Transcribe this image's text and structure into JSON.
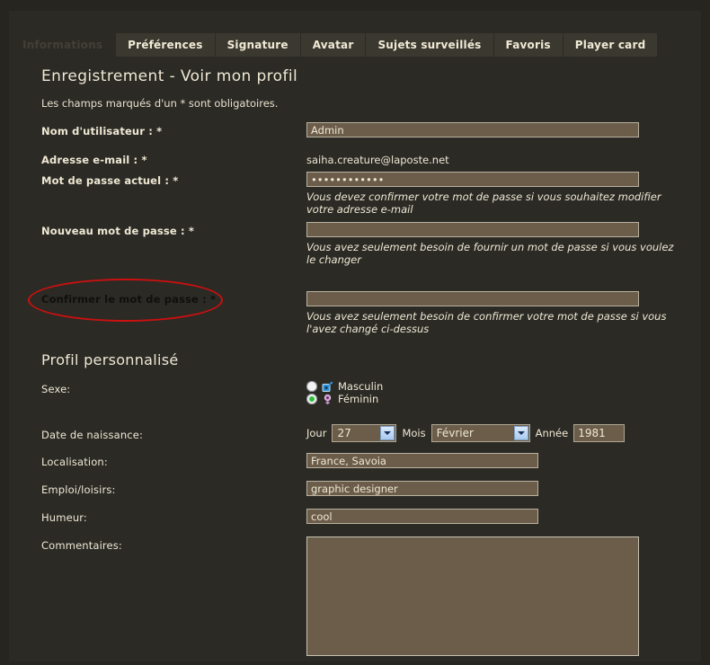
{
  "tabs": [
    {
      "label": "Informations",
      "active": true
    },
    {
      "label": "Préférences",
      "active": false
    },
    {
      "label": "Signature",
      "active": false
    },
    {
      "label": "Avatar",
      "active": false
    },
    {
      "label": "Sujets surveillés",
      "active": false
    },
    {
      "label": "Favoris",
      "active": false
    },
    {
      "label": "Player card",
      "active": false
    }
  ],
  "page": {
    "title": "Enregistrement - Voir mon profil",
    "required_note": "Les champs marqués d'un * sont obligatoires.",
    "profile_section_title": "Profil personnalisé"
  },
  "form": {
    "username": {
      "label": "Nom d'utilisateur : *",
      "value": "Admin"
    },
    "email": {
      "label": "Adresse e-mail : *",
      "value": "saiha.creature@laposte.net"
    },
    "current_password": {
      "label": "Mot de passe actuel : *",
      "value": "••••••••••••",
      "hint": "Vous devez confirmer votre mot de passe si vous souhaitez modifier votre adresse e-mail"
    },
    "new_password": {
      "label": "Nouveau mot de passe : *",
      "value": "",
      "hint": "Vous avez seulement besoin de fournir un mot de passe si vous voulez le changer"
    },
    "confirm_password": {
      "label": "Confirmer le mot de passe : *",
      "value": "",
      "hint": "Vous avez seulement besoin de confirmer votre mot de passe si vous l'avez changé ci-dessus",
      "annotated": true
    },
    "gender": {
      "label": "Sexe:",
      "options": [
        {
          "label": "Masculin",
          "selected": false,
          "icon": "male-symbol-icon"
        },
        {
          "label": "Féminin",
          "selected": true,
          "icon": "female-symbol-icon"
        }
      ]
    },
    "birthdate": {
      "label": "Date de naissance:",
      "day_label": "Jour",
      "day_value": "27",
      "month_label": "Mois",
      "month_value": "Février",
      "year_label": "Année",
      "year_value": "1981"
    },
    "location": {
      "label": "Localisation:",
      "value": "France, Savoia"
    },
    "occupation": {
      "label": "Emploi/loisirs:",
      "value": "graphic designer"
    },
    "mood": {
      "label": "Humeur:",
      "value": "cool"
    },
    "comments": {
      "label": "Commentaires:",
      "value": ""
    }
  },
  "colors": {
    "background": "#26251f",
    "panel": "#2b2a25",
    "input_fill": "#6b5d49",
    "text": "#efe8d4",
    "tab_inactive": "#3b382f",
    "annotation": "#cc1010",
    "radio_selected": "#2fbf3a"
  }
}
